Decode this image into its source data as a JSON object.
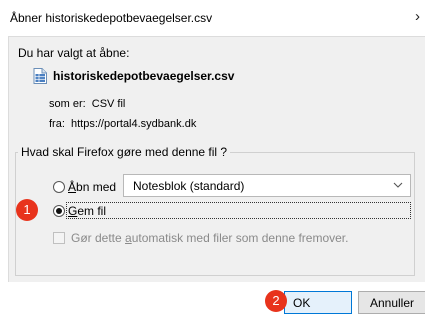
{
  "window": {
    "title": "Åbner historiskedepotbevaegelser.csv",
    "close_glyph": "›"
  },
  "intro": "Du har valgt at åbne:",
  "file": {
    "name": "historiskedepotbevaegelser.csv",
    "type_label": "som er:",
    "type_value": "CSV fil",
    "from_label": "fra:",
    "from_value": "https://portal4.sydbank.dk"
  },
  "action_group": {
    "legend": "Hvad skal Firefox gøre med denne fil ?",
    "open_with": {
      "label_accel": "Å",
      "label_rest": "bn med",
      "selected": false,
      "app": "Notesblok (standard)"
    },
    "save": {
      "label_accel": "G",
      "label_rest": "em fil",
      "selected": true
    },
    "auto": {
      "label_pre": "Gør dette ",
      "label_accel": "a",
      "label_rest": "utomatisk med filer som denne fremover.",
      "checked": false,
      "enabled": false
    }
  },
  "annotations": [
    "1",
    "2"
  ],
  "buttons": {
    "ok": "OK",
    "cancel": "Annuller"
  },
  "colors": {
    "badge": "#e8331c",
    "panel": "#f0f0f0",
    "focus_border": "#0078d7"
  }
}
